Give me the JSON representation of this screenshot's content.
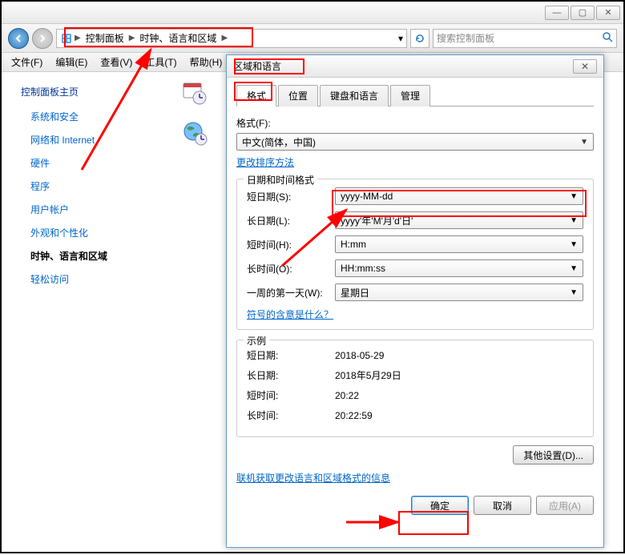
{
  "titlebar": {
    "minimize": "—",
    "maximize": "▢",
    "close": "✕"
  },
  "breadcrumb": {
    "item1": "控制面板",
    "item2": "时钟、语言和区域",
    "sep": "▶"
  },
  "search": {
    "placeholder": "搜索控制面板"
  },
  "menus": {
    "file": "文件(F)",
    "edit": "编辑(E)",
    "view": "查看(V)",
    "tools": "工具(T)",
    "help": "帮助(H)"
  },
  "sidebar": {
    "home": "控制面板主页",
    "items": [
      "系统和安全",
      "网络和 Internet",
      "硬件",
      "程序",
      "用户帐户",
      "外观和个性化",
      "时钟、语言和区域",
      "轻松访问"
    ]
  },
  "dialog": {
    "title": "区域和语言",
    "close": "✕",
    "tabs": {
      "format": "格式",
      "location": "位置",
      "keyboard": "键盘和语言",
      "admin": "管理"
    },
    "format_label": "格式(F):",
    "format_value": "中文(简体，中国)",
    "change_sort": "更改排序方法",
    "datetime_group": "日期和时间格式",
    "short_date_label": "短日期(S):",
    "short_date_value": "yyyy-MM-dd",
    "long_date_label": "长日期(L):",
    "long_date_value": "yyyy'年'M'月'd'日'",
    "short_time_label": "短时间(H):",
    "short_time_value": "H:mm",
    "long_time_label": "长时间(O):",
    "long_time_value": "HH:mm:ss",
    "first_day_label": "一周的第一天(W):",
    "first_day_value": "星期日",
    "notation_link": "符号的含意是什么？",
    "example_group": "示例",
    "ex_short_date_lbl": "短日期:",
    "ex_short_date_val": "2018-05-29",
    "ex_long_date_lbl": "长日期:",
    "ex_long_date_val": "2018年5月29日",
    "ex_short_time_lbl": "短时间:",
    "ex_short_time_val": "20:22",
    "ex_long_time_lbl": "长时间:",
    "ex_long_time_val": "20:22:59",
    "other_settings": "其他设置(D)...",
    "online_link": "联机获取更改语言和区域格式的信息",
    "ok": "确定",
    "cancel": "取消",
    "apply": "应用(A)"
  }
}
